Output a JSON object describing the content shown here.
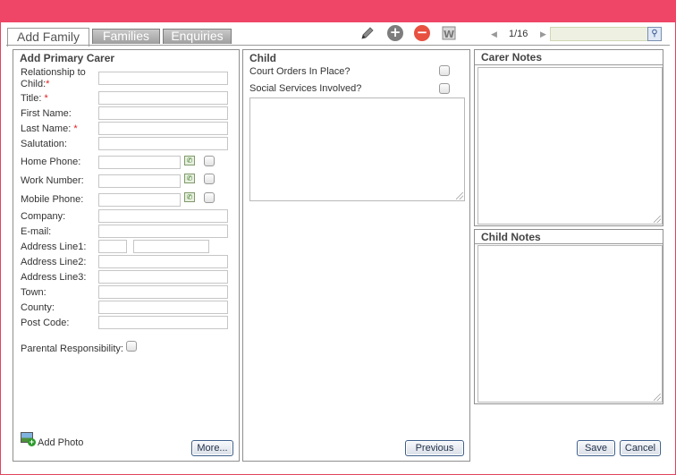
{
  "tabs": [
    {
      "label": "Add Family",
      "active": true
    },
    {
      "label": "Families",
      "active": false
    },
    {
      "label": "Enquiries",
      "active": false
    }
  ],
  "toolbar": {
    "edit_icon": "pencil-icon",
    "add_icon": "plus-circle-icon",
    "remove_icon": "minus-circle-icon",
    "word_icon": "word-document-icon",
    "pager": "1/16",
    "search_value": ""
  },
  "primary_carer": {
    "title": "Add Primary Carer",
    "fields": {
      "relationship": "Relationship to Child:",
      "title": "Title:",
      "first_name": "First Name:",
      "last_name": "Last Name:",
      "salutation": "Salutation:",
      "home_phone": "Home Phone:",
      "work_number": "Work Number:",
      "mobile_phone": "Mobile Phone:",
      "company": "Company:",
      "email": "E-mail:",
      "address1": "Address Line1:",
      "address2": "Address Line2:",
      "address3": "Address Line3:",
      "town": "Town:",
      "county": "County:",
      "post_code": "Post Code:",
      "parental": "Parental Responsibility:"
    },
    "add_photo": "Add Photo",
    "more_button": "More..."
  },
  "child": {
    "title": "Child",
    "court_orders": "Court Orders In Place?",
    "social_services": "Social Services Involved?",
    "previous_button": "Previous"
  },
  "carer_notes": {
    "title": "Carer Notes"
  },
  "child_notes": {
    "title": "Child Notes"
  },
  "actions": {
    "save": "Save",
    "cancel": "Cancel"
  },
  "colors": {
    "topbar": "#ef4567",
    "button_border": "#3d5f8a"
  }
}
